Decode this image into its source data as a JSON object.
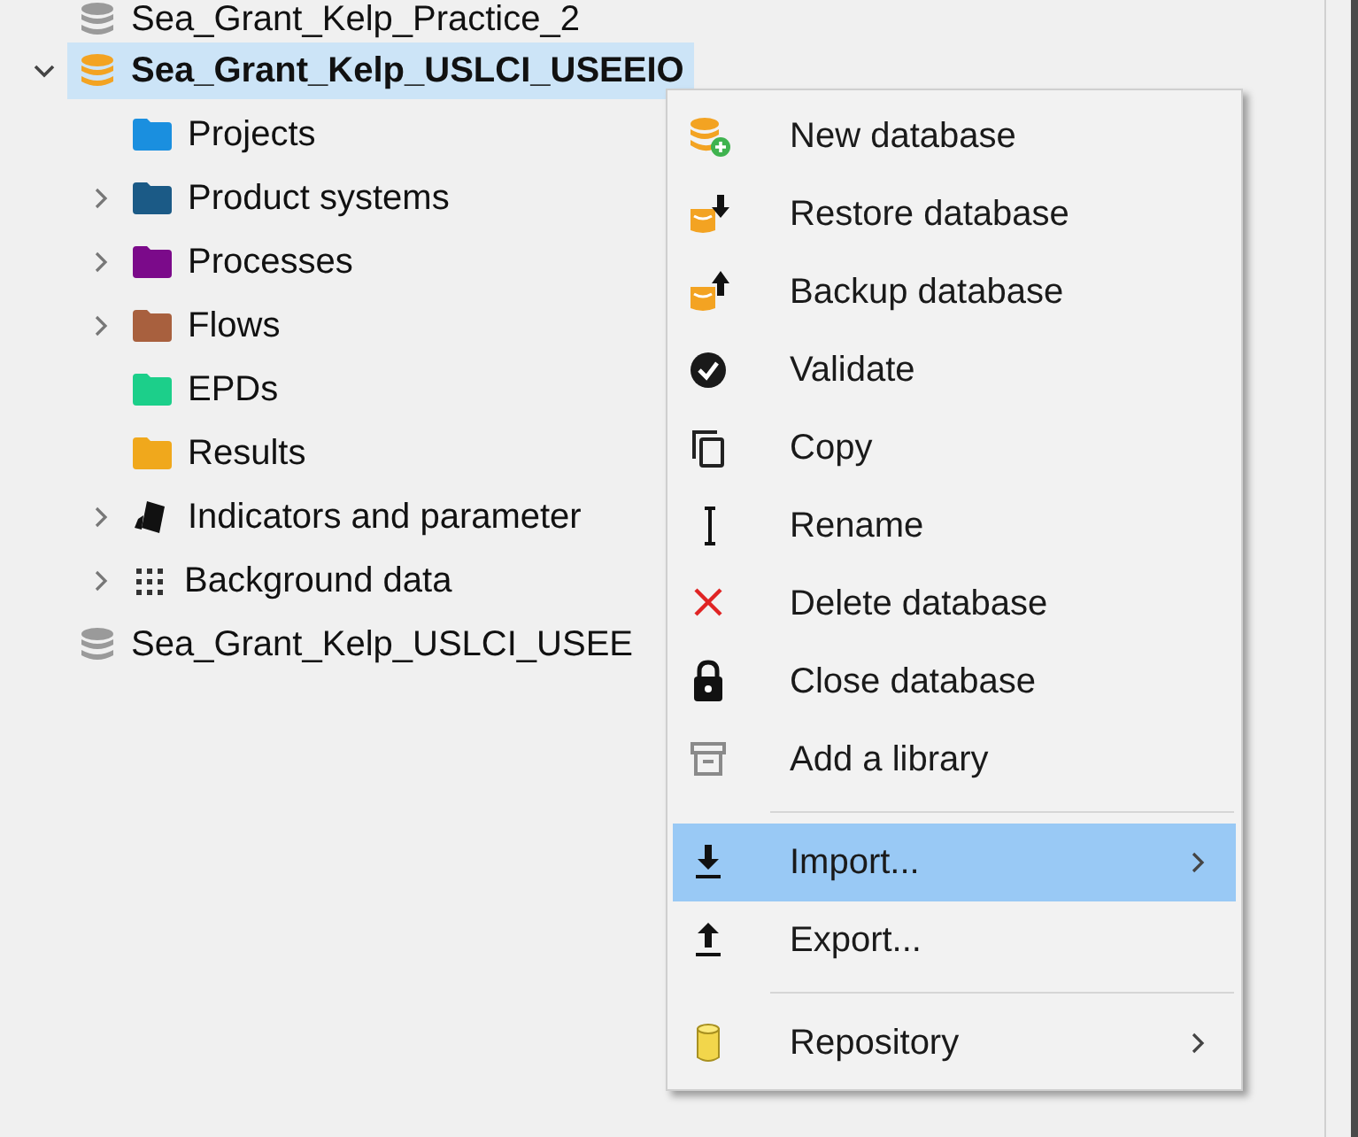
{
  "tree": {
    "items": [
      {
        "label": "Sea_Grant_Kelp_Practice_2",
        "color": "#9a9a9a",
        "selected": false
      },
      {
        "label": "Sea_Grant_Kelp_USLCI_USEEIO",
        "color": "#f3a322",
        "selected": true,
        "expanded": true,
        "children": [
          {
            "label": "Projects",
            "kind": "folder",
            "color": "#1a8fdf"
          },
          {
            "label": "Product systems",
            "kind": "folder",
            "color": "#1b5a86",
            "expanded": false
          },
          {
            "label": "Processes",
            "kind": "folder",
            "color": "#7b0a8a",
            "expanded": false
          },
          {
            "label": "Flows",
            "kind": "folder",
            "color": "#a8603e",
            "expanded": false
          },
          {
            "label": "EPDs",
            "kind": "folder",
            "color": "#1ccf8a"
          },
          {
            "label": "Results",
            "kind": "folder",
            "color": "#f0a81c"
          },
          {
            "label": "Indicators and parameter",
            "kind": "indicators",
            "expanded": false
          },
          {
            "label": "Background data",
            "kind": "background",
            "expanded": false
          }
        ]
      },
      {
        "label": "Sea_Grant_Kelp_USLCI_USEE",
        "color": "#9a9a9a",
        "selected": false
      }
    ]
  },
  "context_menu": {
    "items": [
      {
        "kind": "item",
        "label": "New database",
        "selected": false
      },
      {
        "kind": "item",
        "label": "Restore database",
        "selected": false
      },
      {
        "kind": "item",
        "label": "Backup database",
        "selected": false
      },
      {
        "kind": "item",
        "label": "Validate",
        "selected": false
      },
      {
        "kind": "item",
        "label": "Copy",
        "selected": false
      },
      {
        "kind": "item",
        "label": "Rename",
        "selected": false
      },
      {
        "kind": "item",
        "label": "Delete database",
        "selected": false
      },
      {
        "kind": "item",
        "label": "Close database",
        "selected": false
      },
      {
        "kind": "item",
        "label": "Add a library",
        "selected": false
      },
      {
        "kind": "separator"
      },
      {
        "kind": "item",
        "label": "Import...",
        "selected": true,
        "submenu": true
      },
      {
        "kind": "item",
        "label": "Export...",
        "selected": false
      },
      {
        "kind": "separator"
      },
      {
        "kind": "item",
        "label": "Repository",
        "selected": false,
        "submenu": true
      }
    ]
  }
}
